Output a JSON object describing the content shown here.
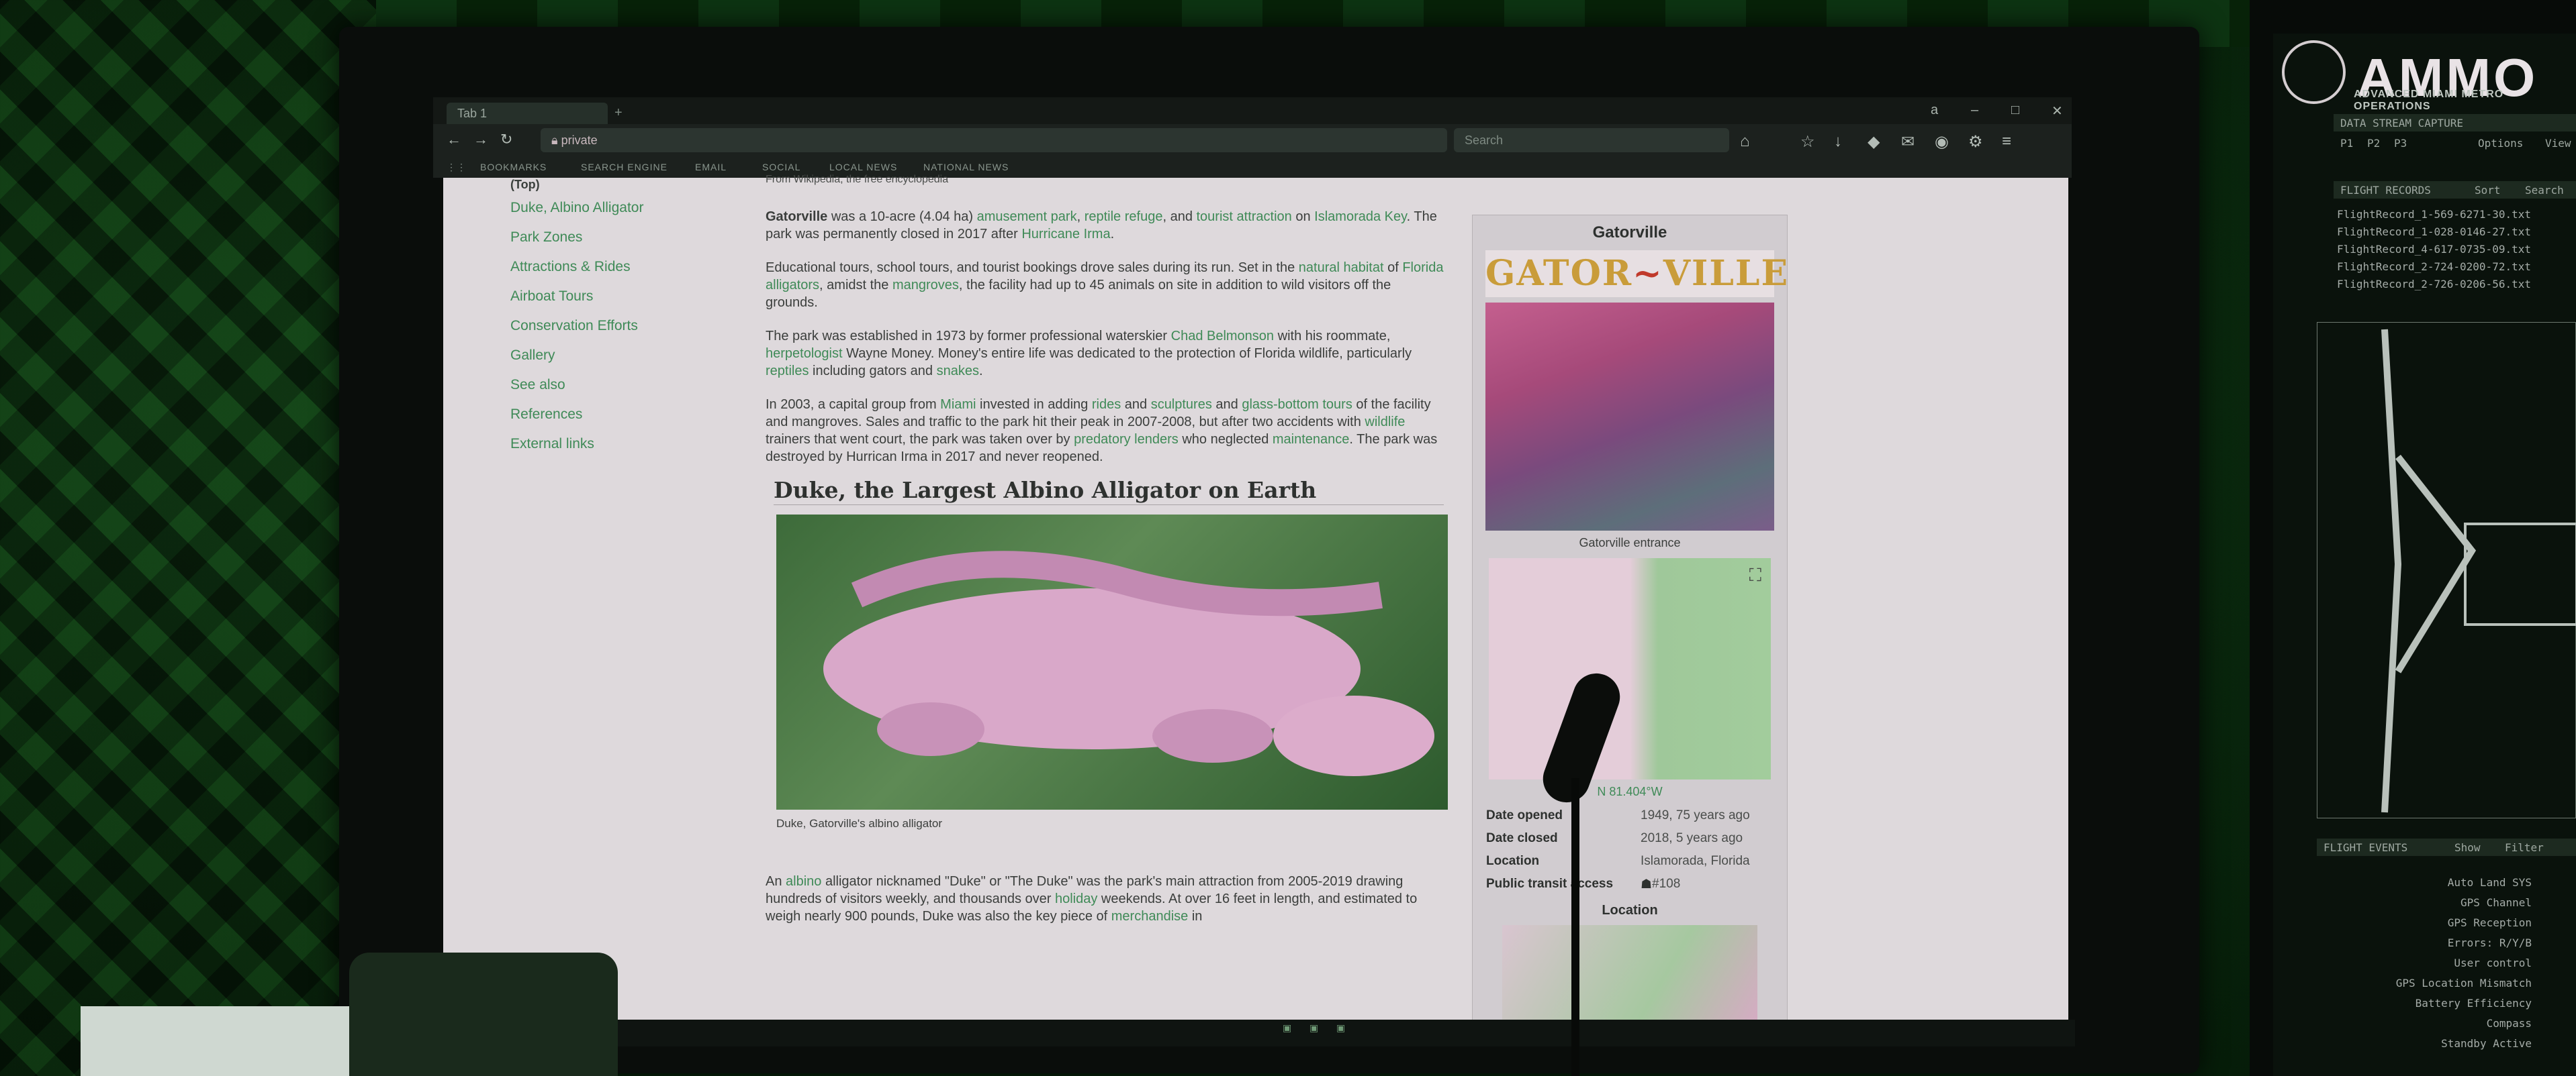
{
  "browser": {
    "tab_label": "Tab 1",
    "url": "private",
    "search_placeholder": "Search",
    "bookmarks": [
      "BOOKMARKS",
      "SEARCH ENGINE",
      "EMAIL",
      "SOCIAL",
      "LOCAL NEWS",
      "NATIONAL NEWS"
    ]
  },
  "toc": {
    "top_label": "(Top)",
    "items": [
      "Duke, Albino Alligator",
      "Park Zones",
      "Attractions & Rides",
      "Airboat Tours",
      "Conservation Efforts",
      "Gallery",
      "See also",
      "References",
      "External links"
    ]
  },
  "article": {
    "from_line": "From Wikipedia, the free encyclopedia",
    "p1_bold": "Gatorville",
    "p1_a": " was a 10-acre (4.04 ha) ",
    "p1_l1": "amusement park",
    "p1_b": ", ",
    "p1_l2": "reptile refuge",
    "p1_c": ", and ",
    "p1_l3": "tourist attraction",
    "p1_d": " on ",
    "p1_l4": "Islamorada Key",
    "p1_e": ". The park was permanently closed in 2017 after ",
    "p1_l5": "Hurricane Irma",
    "p1_f": ".",
    "p2_a": "Educational tours, school tours, and tourist bookings drove sales during its run. Set in the ",
    "p2_l1": "natural habitat",
    "p2_b": " of ",
    "p2_l2": "Florida alligators",
    "p2_c": ", amidst the ",
    "p2_l3": "mangroves",
    "p2_d": ", the facility had up to 45 animals on site in addition to wild visitors off the grounds.",
    "p3_a": "The park was established in 1973 by former professional waterskier ",
    "p3_l1": "Chad Belmonson",
    "p3_b": " with his roommate, ",
    "p3_l2": "herpetologist",
    "p3_c": " Wayne Money. Money's entire life was dedicated to the protection of Florida wildlife, particularly ",
    "p3_l3": "reptiles",
    "p3_d": " including gators and ",
    "p3_l4": "snakes",
    "p3_e": ".",
    "p4_a": "In 2003, a capital group from ",
    "p4_l1": "Miami",
    "p4_b": " invested in adding ",
    "p4_l2": "rides",
    "p4_c": " and ",
    "p4_l3": "sculptures",
    "p4_d": " and ",
    "p4_l4": "glass-bottom tours",
    "p4_e": " of the facility and mangroves. Sales and traffic to the park hit their peak in 2007-2008, but after two accidents with ",
    "p4_l5": "wildlife",
    "p4_f": " trainers that went court, the park was taken over by ",
    "p4_l6": "predatory lenders",
    "p4_g": " who neglected ",
    "p4_l7": "maintenance",
    "p4_h": ". The park was destroyed by Hurrican Irma in 2017 and never reopened.",
    "section_heading": "Duke, the Largest Albino Alligator on Earth",
    "figure_caption": "Duke, Gatorville's albino alligator",
    "p5_a": "An ",
    "p5_l1": "albino",
    "p5_b": " alligator nicknamed \"Duke\" or \"The Duke\" was the park's main attraction from 2005-2019 drawing hundreds of visitors weekly, and thousands over ",
    "p5_l2": "holiday",
    "p5_c": " weekends. At over 16 feet in length, and estimated to weigh nearly 900 pounds, Duke was also the key piece of ",
    "p5_l3": "merchandise",
    "p5_d": " in"
  },
  "infobox": {
    "title": "Gatorville",
    "logo_text_left": "GATOR",
    "logo_text_right": "VILLE",
    "photo_caption": "Gatorville entrance",
    "coords": "N 81.404°W",
    "rows": [
      {
        "label": "Date opened",
        "value": "1949, 75 years ago"
      },
      {
        "label": "Date closed",
        "value": "2018, 5 years ago"
      },
      {
        "label": "Location",
        "value": "Islamorada, Florida"
      },
      {
        "label": "Public transit access",
        "value": "#108"
      }
    ],
    "location_heading": "Location"
  },
  "side_monitor": {
    "title": "AMMO",
    "subtitle": "ADVANCED MIAMI METRO OPERATIONS",
    "stream_header": "DATA STREAM CAPTURE",
    "stream_tabs": [
      "P1",
      "P2",
      "P3",
      "Options",
      "View"
    ],
    "records_header": "FLIGHT RECORDS",
    "records_actions": [
      "Sort",
      "Search"
    ],
    "records": [
      "FlightRecord_1-569-6271-30.txt",
      "FlightRecord_1-028-0146-27.txt",
      "FlightRecord_4-617-0735-09.txt",
      "FlightRecord_2-724-0200-72.txt",
      "FlightRecord_2-726-0206-56.txt"
    ],
    "events_header": "FLIGHT EVENTS",
    "events_actions": [
      "Show",
      "Filter"
    ],
    "events": [
      "Auto Land SYS",
      "GPS Channel",
      "GPS Reception",
      "Errors: R/Y/B",
      "User control",
      "GPS Location Mismatch",
      "Battery Efficiency",
      "Compass",
      "Standby Active"
    ]
  },
  "colors": {
    "link": "#3f8a57",
    "ambient": "#0a2a0e",
    "page_bg": "#ded9dc"
  }
}
